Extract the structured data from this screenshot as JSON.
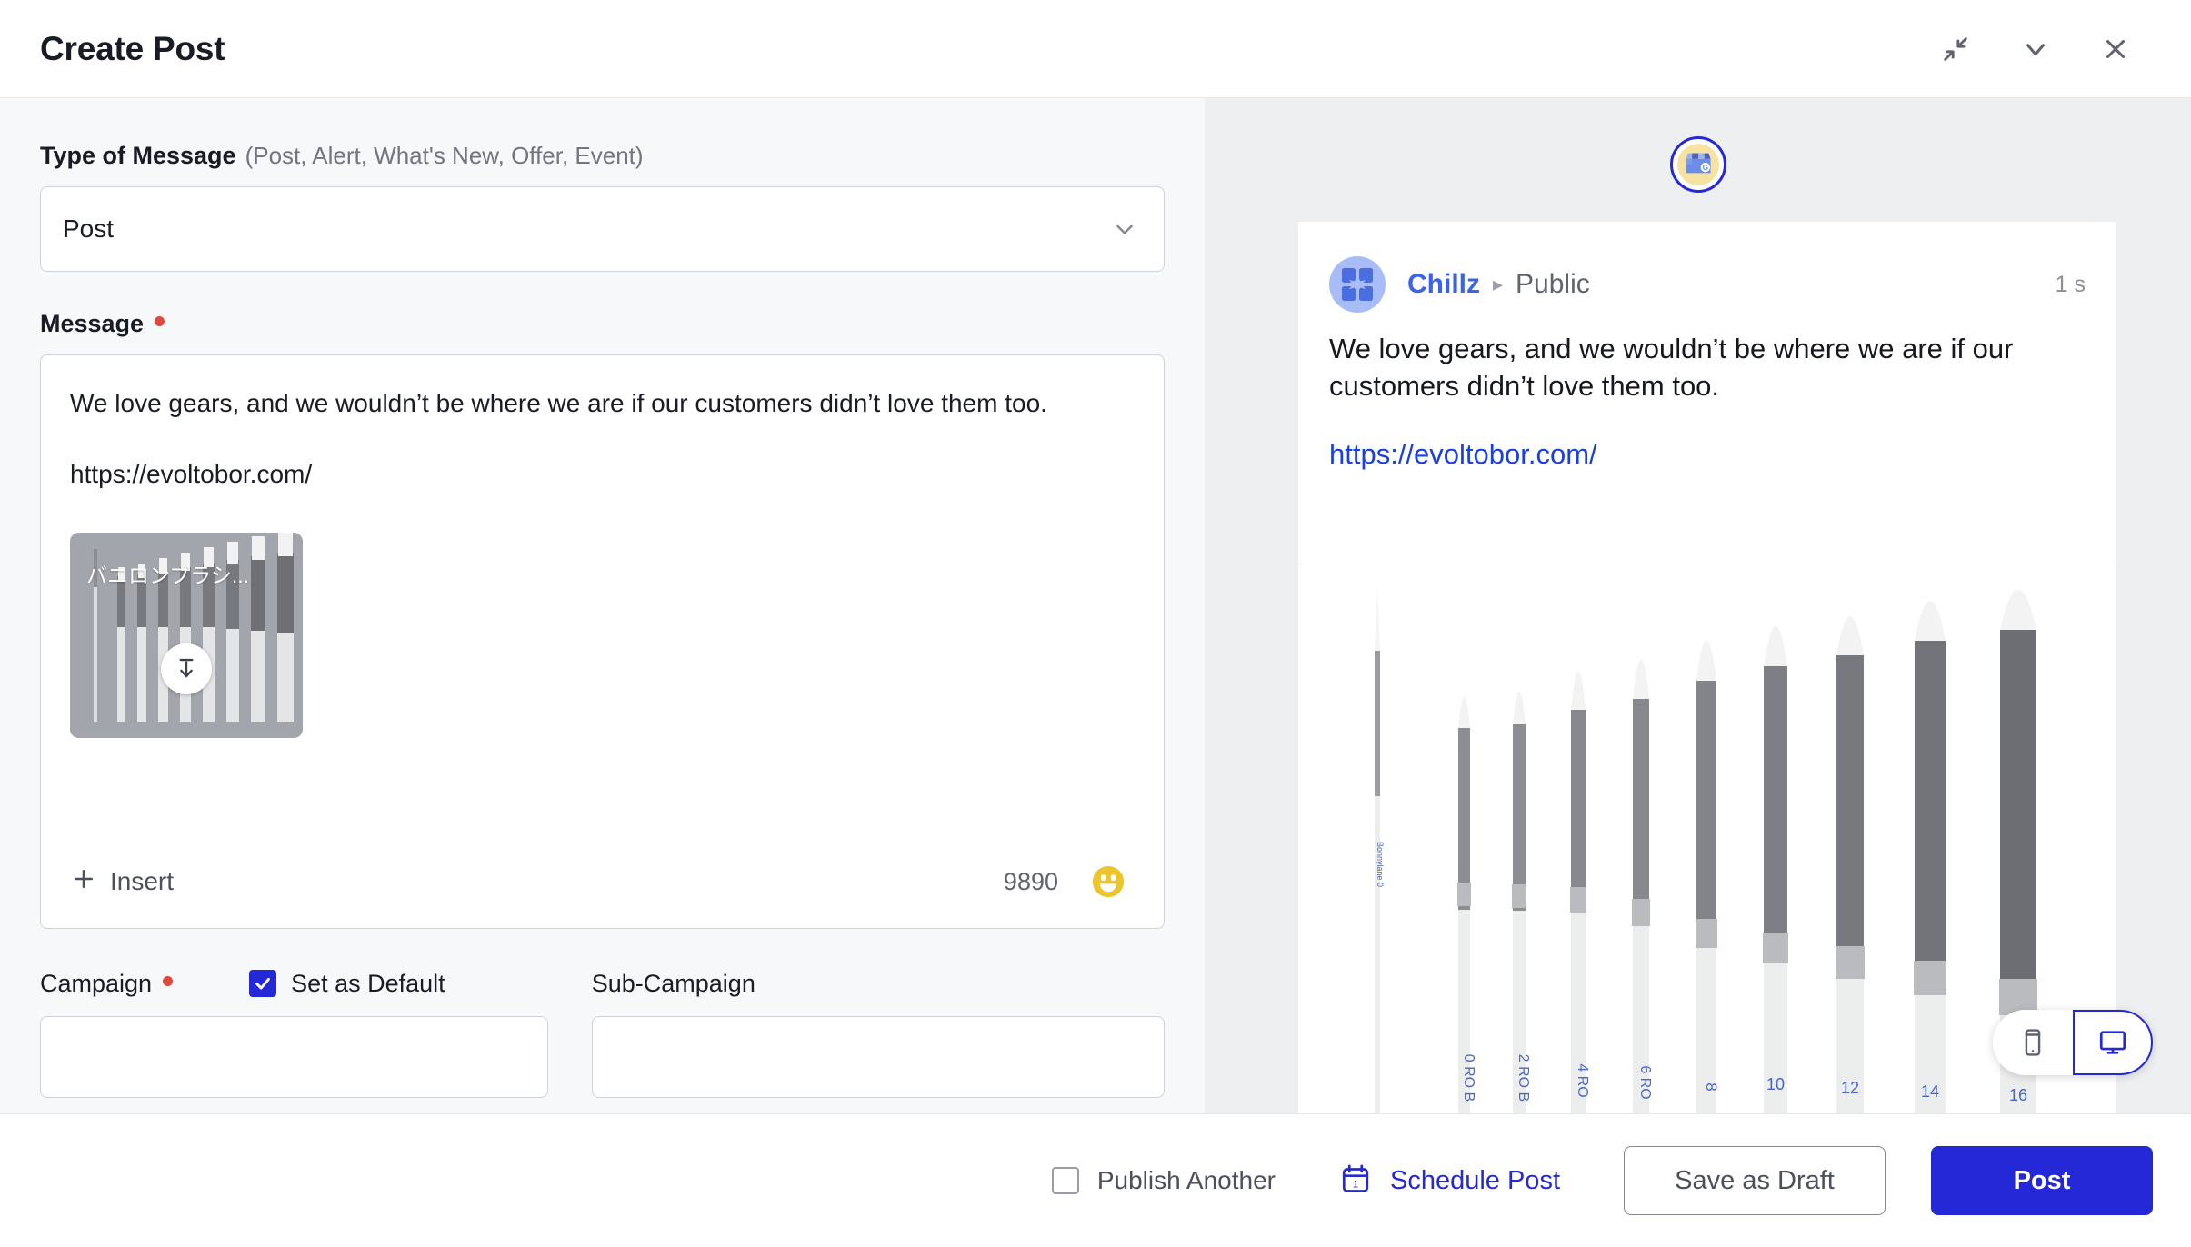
{
  "header": {
    "title": "Create Post",
    "actions": [
      {
        "name": "collapse-icon",
        "label": "Collapse"
      },
      {
        "name": "chevron-down-icon",
        "label": "Minimize"
      },
      {
        "name": "close-icon",
        "label": "Close"
      }
    ]
  },
  "form": {
    "type_of_message": {
      "label": "Type of Message",
      "hint": "(Post, Alert, What's New, Offer, Event)",
      "value": "Post",
      "options": [
        "Post",
        "Alert",
        "What's New",
        "Offer",
        "Event"
      ]
    },
    "message": {
      "label": "Message",
      "required": true,
      "text": "We love gears, and we wouldn’t be where we are if our customers didn’t love them too.",
      "link": "https://evoltobor.com/",
      "attachment": {
        "caption": "バニロンブラシ...",
        "download_icon": "download-icon"
      },
      "insert_label": "Insert",
      "char_count": "9890",
      "emoji_icon": "emoji-smiley-icon"
    },
    "campaign": {
      "label": "Campaign",
      "required": true,
      "value": "",
      "set_as_default_label": "Set as Default",
      "set_as_default_checked": true
    },
    "sub_campaign": {
      "label": "Sub-Campaign",
      "value": ""
    }
  },
  "preview": {
    "platform_badge": "google-business-profile-icon",
    "post": {
      "brand": "Chillz",
      "separator": "▸",
      "audience": "Public",
      "timestamp": "1 s",
      "text": "We love gears, and we wouldn’t be where we are if our customers didn’t love them too.",
      "link": "https://evoltobor.com/",
      "media_alt": "Set of nine white-handled round paint brushes in increasing sizes",
      "media_labels": [
        "0",
        "2",
        "4",
        "6",
        "8",
        "10",
        "12",
        "14",
        "16"
      ]
    },
    "device_toggle": {
      "mobile": {
        "icon": "mobile-icon",
        "active": false
      },
      "desktop": {
        "icon": "desktop-icon",
        "active": true
      }
    }
  },
  "footer": {
    "publish_another": {
      "label": "Publish Another",
      "checked": false
    },
    "schedule_post": {
      "label": "Schedule Post",
      "icon": "calendar-icon",
      "day": "1"
    },
    "save_as_draft": "Save as Draft",
    "post": "Post"
  },
  "colors": {
    "accent": "#2528d6",
    "link": "#1a3ee8",
    "brand_text": "#3a63e8",
    "required_dot": "#e0493c",
    "left_panel_bg": "#f7f8fa",
    "right_panel_bg": "#eeeff1"
  }
}
